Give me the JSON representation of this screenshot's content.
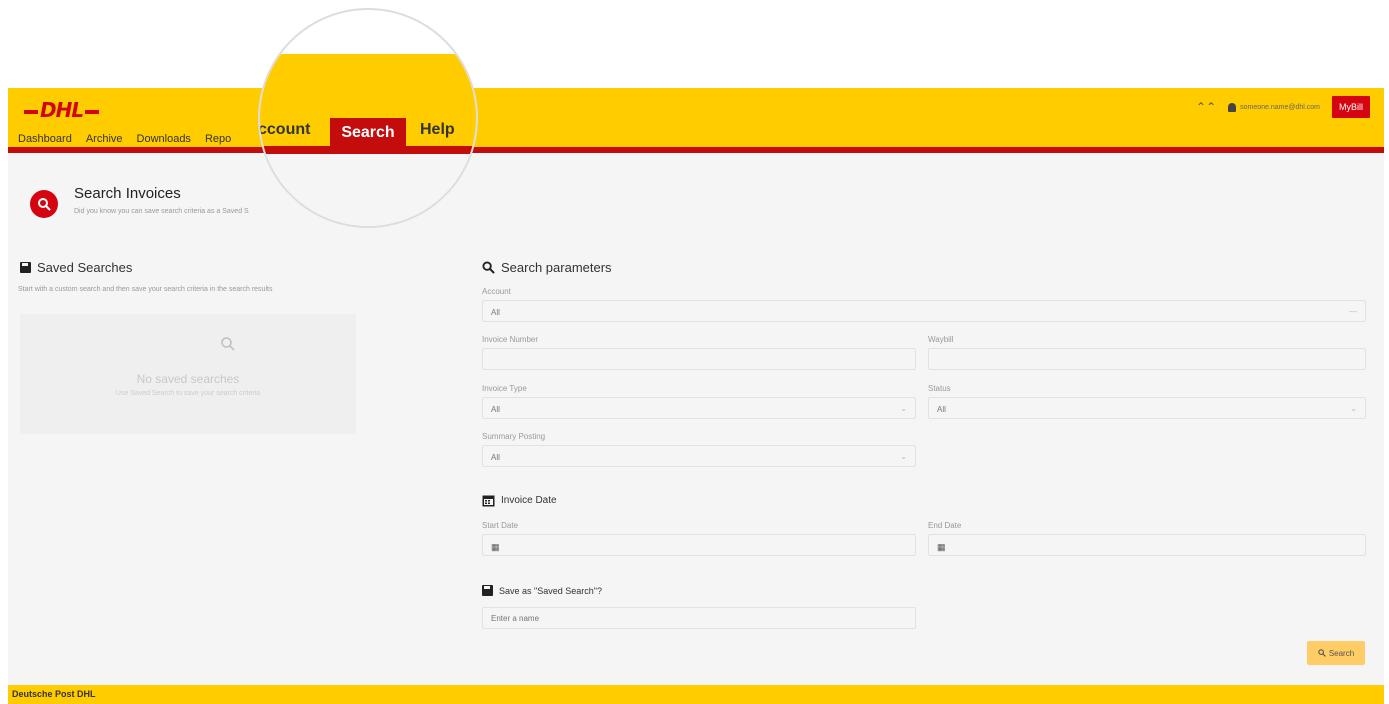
{
  "header": {
    "logo": "DHL",
    "user_email": "someone.name@dhl.com",
    "mybill_label": "MyBill"
  },
  "nav": {
    "items": [
      "Dashboard",
      "Archive",
      "Downloads",
      "Repo"
    ]
  },
  "magnifier": {
    "account_label": "ccount",
    "search_label": "Search",
    "help_label": "Help"
  },
  "page": {
    "title": "Search Invoices",
    "subtitle": "Did you know you can save search criteria as a Saved S"
  },
  "saved_searches": {
    "title": "Saved Searches",
    "description": "Start with a custom search and then save your search criteria in the search results",
    "empty_title": "No saved searches",
    "empty_sub": "Use Saved Search to save your search criteria"
  },
  "search_params": {
    "title": "Search parameters",
    "account_label": "Account",
    "account_value": "All",
    "invoice_number_label": "Invoice Number",
    "waybill_label": "Waybill",
    "invoice_type_label": "Invoice Type",
    "invoice_type_value": "All",
    "status_label": "Status",
    "status_value": "All",
    "summary_posting_label": "Summary Posting",
    "summary_posting_value": "All"
  },
  "invoice_date": {
    "title": "Invoice Date",
    "start_label": "Start Date",
    "end_label": "End Date"
  },
  "save_search": {
    "title": "Save as \"Saved Search\"?",
    "placeholder": "Enter a name"
  },
  "actions": {
    "search_label": "Search"
  },
  "footer": {
    "text": "Deutsche Post DHL"
  },
  "colors": {
    "brand_yellow": "#ffcc00",
    "brand_red": "#d40511"
  }
}
